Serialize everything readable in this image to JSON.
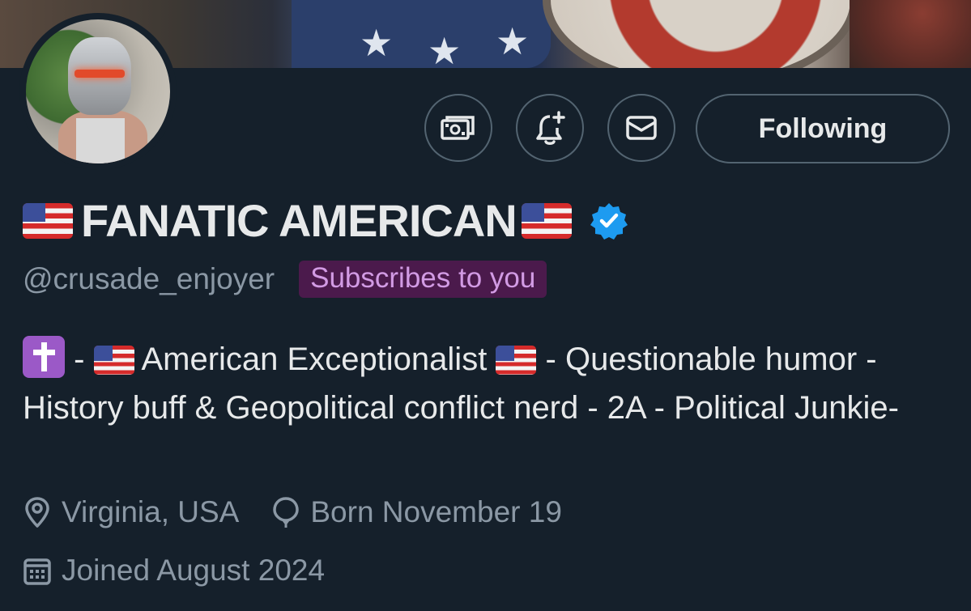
{
  "profile": {
    "display_name": "FANATIC AMERICAN",
    "handle": "@crusade_enjoyer",
    "badge": "Subscribes to you",
    "verified": true,
    "bio": {
      "p1": " - ",
      "p2": "American Exceptionalist ",
      "p3": " - Questionable humor - History buff & Geopolitical conflict nerd - 2A - Political Junkie-"
    },
    "location": "Virginia, USA",
    "birthday": "Born November 19",
    "joined": "Joined August 2024"
  },
  "actions": {
    "following_label": "Following",
    "icons": [
      "money-icon",
      "notification-bell-icon",
      "envelope-icon"
    ]
  },
  "colors": {
    "background": "#15202b",
    "text_primary": "#e7e9ea",
    "text_secondary": "#8b98a5",
    "verified_blue": "#1d9bf0",
    "badge_bg": "#4b1a4c",
    "badge_text": "#d29be4"
  }
}
